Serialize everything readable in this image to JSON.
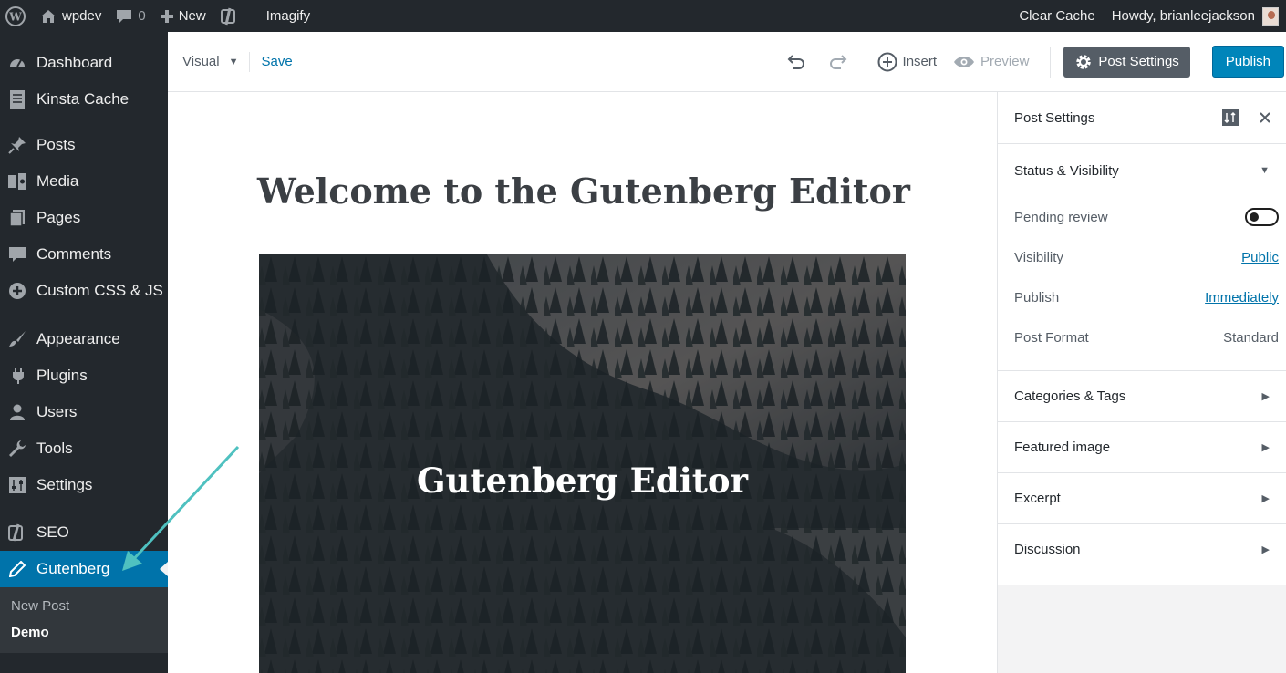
{
  "admin_bar": {
    "site_name": "wpdev",
    "comments_count": "0",
    "new_label": "New",
    "imagify_label": "Imagify",
    "clear_cache_label": "Clear Cache",
    "howdy_label": "Howdy, brianleejackson"
  },
  "sidebar": {
    "items": [
      {
        "label": "Dashboard",
        "icon": "dashboard-icon"
      },
      {
        "label": "Kinsta Cache",
        "icon": "cache-icon"
      },
      {
        "label": "Posts",
        "icon": "pin-icon"
      },
      {
        "label": "Media",
        "icon": "media-icon"
      },
      {
        "label": "Pages",
        "icon": "pages-icon"
      },
      {
        "label": "Comments",
        "icon": "comment-icon"
      },
      {
        "label": "Custom CSS & JS",
        "icon": "plus-circle-icon"
      },
      {
        "label": "Appearance",
        "icon": "brush-icon"
      },
      {
        "label": "Plugins",
        "icon": "plug-icon"
      },
      {
        "label": "Users",
        "icon": "user-icon"
      },
      {
        "label": "Tools",
        "icon": "wrench-icon"
      },
      {
        "label": "Settings",
        "icon": "sliders-icon"
      },
      {
        "label": "SEO",
        "icon": "yoast-icon"
      },
      {
        "label": "Gutenberg",
        "icon": "pencil-icon"
      }
    ],
    "submenu": [
      "New Post",
      "Demo"
    ]
  },
  "toolbar": {
    "mode_label": "Visual",
    "save_label": "Save",
    "insert_label": "Insert",
    "preview_label": "Preview",
    "post_settings_label": "Post Settings",
    "publish_label": "Publish"
  },
  "content": {
    "post_title": "Welcome to the Gutenberg Editor",
    "cover_title": "Gutenberg Editor"
  },
  "panel": {
    "title": "Post Settings",
    "status_section": "Status & Visibility",
    "rows": {
      "pending_review": "Pending review",
      "visibility_label": "Visibility",
      "visibility_value": "Public",
      "publish_label": "Publish",
      "publish_value": "Immediately",
      "format_label": "Post Format",
      "format_value": "Standard"
    },
    "sections": [
      "Categories & Tags",
      "Featured image",
      "Excerpt",
      "Discussion"
    ]
  },
  "colors": {
    "admin_dark": "#23282d",
    "accent_blue": "#0073aa",
    "publish_blue": "#0085ba",
    "annotation_arrow": "#4fc1c0"
  }
}
